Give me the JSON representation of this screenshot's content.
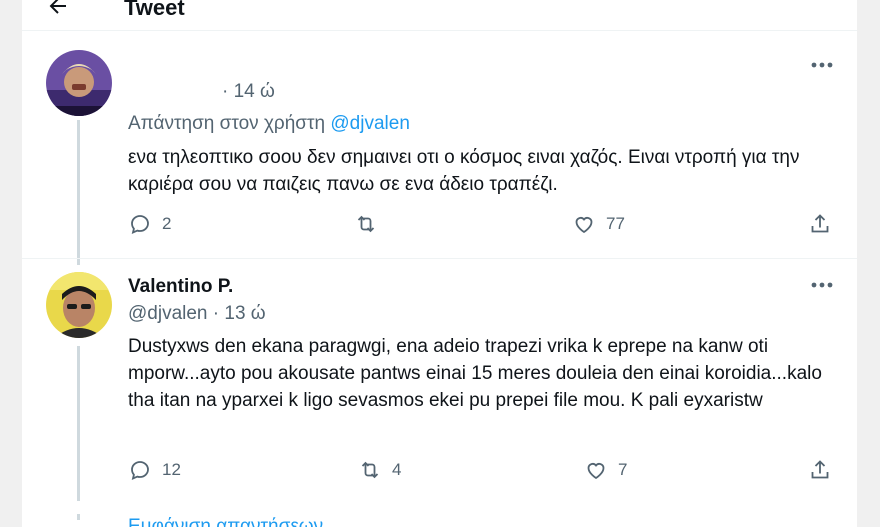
{
  "header": {
    "title": "Tweet"
  },
  "tweet1": {
    "display_name": "",
    "time": "14 ώ",
    "reply_to_prefix": "Απάντηση στον χρήστη",
    "reply_to_handle": "@djvalen",
    "text": "ενα τηλεοπτικο σοου δεν σημαινει οτι ο κόσμος ειναι χαζός. Ειναι ντροπή για την καριέρα σου να παιζεις πανω σε ενα άδειο τραπέζι.",
    "replies": "2",
    "retweets": "",
    "likes": "77"
  },
  "tweet2": {
    "display_name": "Valentino P.",
    "handle": "@djvalen",
    "time": "13 ώ",
    "text": "Dustyxws den ekana paragwgi, ena adeio trapezi vrika k eprepe na kanw oti mporw...ayto pou akousate pantws einai 15 meres douleia den einai koroidia...kalo tha itan na yparxei k ligo sevasmos ekei pu prepei file mou. K pali eyxaristw",
    "replies": "12",
    "retweets": "4",
    "likes": "7"
  },
  "footer": {
    "show_replies": "Εμφάνιση απαντήσεων"
  },
  "colors": {
    "accent": "#1d9bf0",
    "secondary_text": "#536471",
    "thread_line": "#cfd9de"
  },
  "icons": [
    "back-arrow-icon",
    "more-icon",
    "reply-icon",
    "retweet-icon",
    "like-icon",
    "share-icon"
  ]
}
